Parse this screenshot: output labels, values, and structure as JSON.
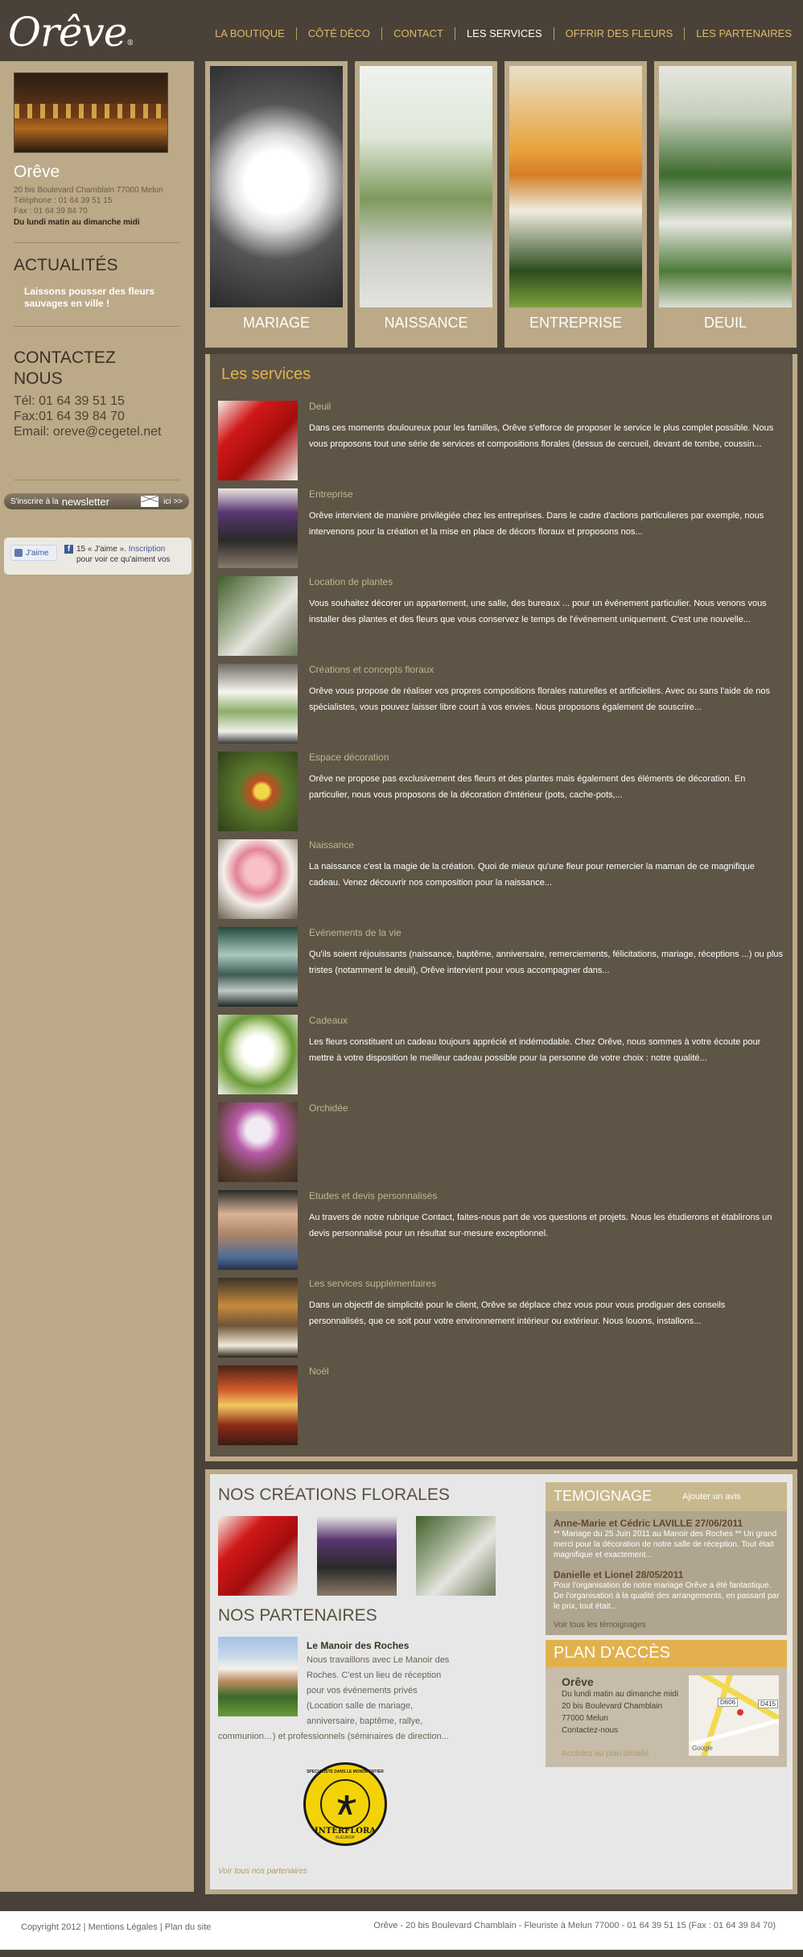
{
  "header": {
    "logo": "Orêve",
    "logo_mark": "®",
    "nav": [
      {
        "label": "LA BOUTIQUE",
        "active": false
      },
      {
        "label": "CÔTÉ DÉCO",
        "active": false
      },
      {
        "label": "CONTACT",
        "active": false
      },
      {
        "label": "LES SERVICES",
        "active": true
      },
      {
        "label": "OFFRIR DES FLEURS",
        "active": false
      },
      {
        "label": "LES PARTENAIRES",
        "active": false
      }
    ]
  },
  "sidebar": {
    "shop_name": "Orêve",
    "address": "20 bis Boulevard Chamblain 77000 Melun",
    "phone": "Téléphone : 01 64 39 51 15",
    "fax": "Fax : 01 64 39 84 70",
    "hours": "Du lundi matin au dimanche midi",
    "news_heading": "ACTUALITÉS",
    "news_text": "Laissons pousser des fleurs sauvages en ville !",
    "contact_heading_1": "CONTACTEZ",
    "contact_heading_2": "NOUS",
    "contact_tel": "Tél: 01 64 39 51 15",
    "contact_fax": "Fax:01 64 39 84 70",
    "contact_email": "Email: oreve@cegetel.net",
    "newsletter": {
      "pre": "S'inscrire à la",
      "big": "newsletter",
      "post": "ici >>"
    },
    "facebook": {
      "like": "J'aime",
      "count": "15 « J'aime ».",
      "link": "Inscription",
      "rest": "pour voir ce qu'aiment vos"
    }
  },
  "tiles": [
    {
      "label": "MARIAGE"
    },
    {
      "label": "NAISSANCE"
    },
    {
      "label": "ENTREPRISE"
    },
    {
      "label": "DEUIL"
    }
  ],
  "services": {
    "title": "Les services",
    "items": [
      {
        "title": "Deuil",
        "desc": "Dans ces moments douloureux pour les familles, Orêve s'efforce de proposer le service le plus complet possible. Nous vous proposons tout une série de services et compositions florales (dessus de cercueil, devant de tombe, coussin..."
      },
      {
        "title": "Entreprise",
        "desc": "Orêve intervient de manière privilégiée chez les entreprises. Dans le cadre d'actions particulieres par exemple, nous intervenons pour la création et la mise en place de décors floraux et proposons nos..."
      },
      {
        "title": "Location de plantes",
        "desc": "Vous souhaitez décorer un appartement, une salle, des bureaux ... pour un événement particulier. Nous venons vous installer des plantes et des fleurs que vous conservez le temps de l'événement uniquement. C'est une nouvelle..."
      },
      {
        "title": "Créations et concepts floraux",
        "desc": "Orêve vous propose de réaliser vos propres compositions florales naturelles et artificielles. Avec ou sans l'aide de nos spécialistes, vous pouvez laisser libre court à vos envies.   Nous proposons également de souscrire..."
      },
      {
        "title": "Espace décoration",
        "desc": "  Orêve ne propose pas exclusivement des fleurs et des plantes mais également des éléments de décoration. En particulier, nous vous proposons de la décoration d'intérieur (pots, cache-pots,..."
      },
      {
        "title": "Naissance",
        "desc": "La naissance c'est la magie de la création. Quoi de mieux qu'une fleur pour remercier la maman de ce magnifique cadeau. Venez découvrir nos composition pour la naissance..."
      },
      {
        "title": "Evénements de la vie",
        "desc": "Qu'ils soient réjouissants (naissance, baptême, anniversaire, remerciements, félicitations, mariage, réceptions ...) ou plus tristes (notamment le deuil), Orêve intervient pour vous accompagner dans..."
      },
      {
        "title": "Cadeaux",
        "desc": "Les fleurs constituent un cadeau toujours apprécié et indémodable. Chez Orêve, nous sommes à votre écoute pour mettre à votre disposition le meilleur cadeau possible pour la personne de votre choix : notre qualité..."
      },
      {
        "title": "Orchidée",
        "desc": ""
      },
      {
        "title": "Etudes et devis personnalisés",
        "desc": "Au travers de notre rubrique Contact, faites-nous part de vos questions et projets. Nous les étudierons et établirons un devis  personnalisé pour un résultat sur-mesure exceptionnel."
      },
      {
        "title": "Les services supplémentaires",
        "desc": "Dans un objectif de simplicité pour le client, Orêve se déplace chez vous pour vous prodiguer des conseils personnalisés, que ce soit pour votre environnement intérieur ou extérieur. Nous louons, installons..."
      },
      {
        "title": "Noël",
        "desc": ""
      }
    ]
  },
  "creations": {
    "title": "NOS CRÉATIONS FLORALES"
  },
  "partners": {
    "title": "NOS PARTENAIRES",
    "name": "Le Manoir des Roches",
    "desc_lines": [
      "Nous travaillons avec Le Manoir des",
      "Roches. C'est un lieu de réception",
      "pour vos événements privés",
      "(Location salle de mariage,",
      "anniversaire, baptême, rallye,"
    ],
    "desc_last": "communion…) et professionnels (séminaires de direction...",
    "interflora_top": "SPECIALISTE DANS LE MONDE ENTIER",
    "interflora_mid": "FLEUROP",
    "interflora_brand": "INTERFLORA",
    "all_link": "Voir tous nos partenaires"
  },
  "testimonial": {
    "title": "TEMOIGNAGE",
    "add": "Ajouter un avis",
    "entries": [
      {
        "name": "Anne-Marie et Cédric LAVILLE 27/06/2011",
        "text": "** Mariage du 25 Juin 2011 au Manoir des Roches ** Un grand merci pour la décoration de notre salle de réception. Tout était magnifique et exactement..."
      },
      {
        "name": "Danielle et Lionel 28/05/2011",
        "text": "Pour l'organisation de notre mariage Orêve a été fantastique. De l'organisation à la qualité des arrangements, en passant par le prix, tout était..."
      }
    ],
    "all": "Voir tous les témoignages"
  },
  "plan": {
    "title": "PLAN D'ACCÈS",
    "name": "Orêve",
    "lines": [
      "Du lundi matin au dimanche midi",
      "20 bis Boulevard Chamblain",
      "77000 Melun",
      "Contactez-nous"
    ],
    "link": "Accédez au plan détaillé",
    "map_labels": [
      "D606",
      "D415",
      "Google"
    ]
  },
  "footer": {
    "left": "Copyright   2012 | Mentions Légales | Plan du site",
    "right": "Orêve - 20 bis Boulevard Chamblain - Fleuriste à Melun 77000 - 01 64 39 51 15 (Fax : 01 64 39 84 70)"
  }
}
